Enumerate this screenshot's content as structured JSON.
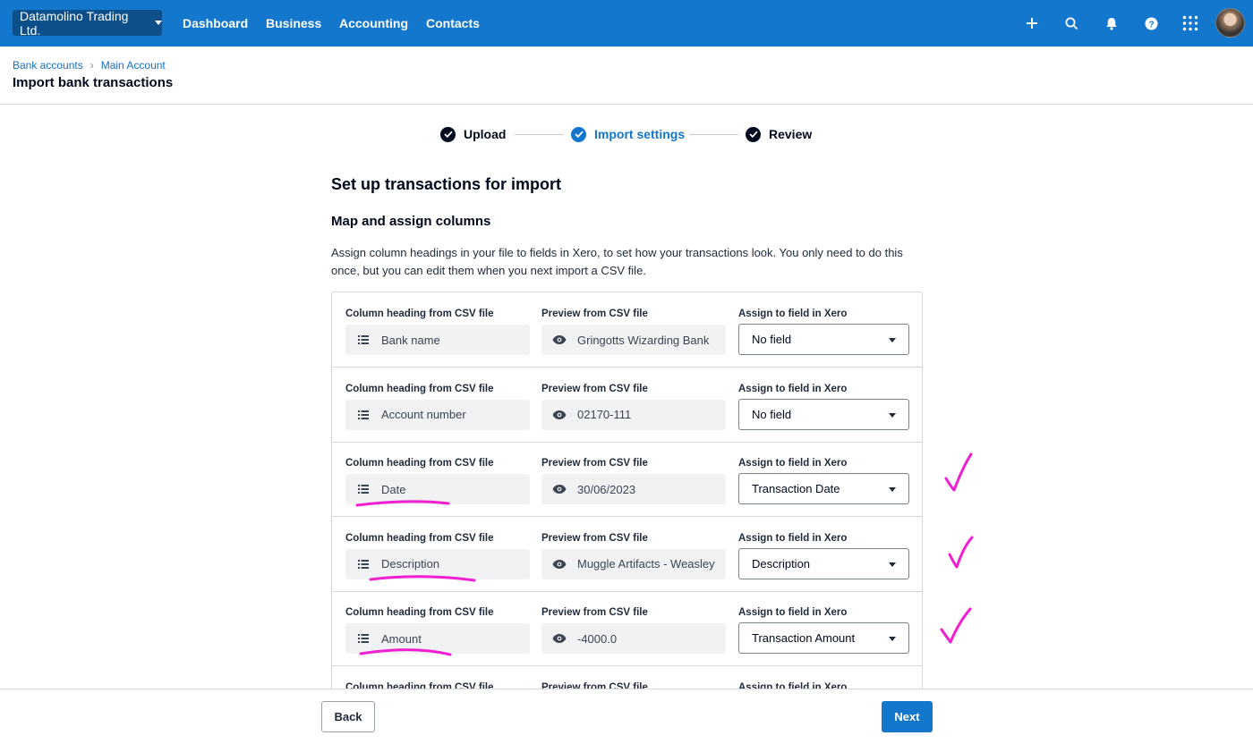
{
  "topbar": {
    "org_name": "Datamolino Trading Ltd.",
    "nav": [
      "Dashboard",
      "Business",
      "Accounting",
      "Contacts"
    ],
    "icons": [
      "plus-icon",
      "search-icon",
      "bell-icon",
      "help-icon",
      "apps-grid-icon",
      "user-avatar"
    ]
  },
  "header": {
    "breadcrumbs": [
      "Bank accounts",
      "Main Account"
    ],
    "title": "Import bank transactions"
  },
  "stepper": {
    "steps": [
      {
        "label": "Upload",
        "state": "done"
      },
      {
        "label": "Import settings",
        "state": "current"
      },
      {
        "label": "Review",
        "state": "done"
      }
    ]
  },
  "content": {
    "heading": "Set up transactions for import",
    "subheading": "Map and assign columns",
    "description": "Assign column headings in your file to fields in Xero, to set how your transactions look. You only need to do this once, but you can edit them when you next import a CSV file."
  },
  "columns": {
    "csv_heading_label": "Column heading from CSV file",
    "preview_label": "Preview from CSV file",
    "assign_label": "Assign to field in Xero"
  },
  "rows": [
    {
      "heading": "Bank name",
      "preview": "Gringotts Wizarding Bank",
      "field": "No field"
    },
    {
      "heading": "Account number",
      "preview": "02170-111",
      "field": "No field"
    },
    {
      "heading": "Date",
      "preview": "30/06/2023",
      "field": "Transaction Date"
    },
    {
      "heading": "Description",
      "preview": "Muggle Artifacts - Weasley",
      "field": "Description"
    },
    {
      "heading": "Amount",
      "preview": "-4000.0",
      "field": "Transaction Amount"
    }
  ],
  "footer": {
    "back_label": "Back",
    "next_label": "Next"
  },
  "colors": {
    "brand_blue": "#1377cd",
    "annotation_magenta": "#f01fd2"
  }
}
